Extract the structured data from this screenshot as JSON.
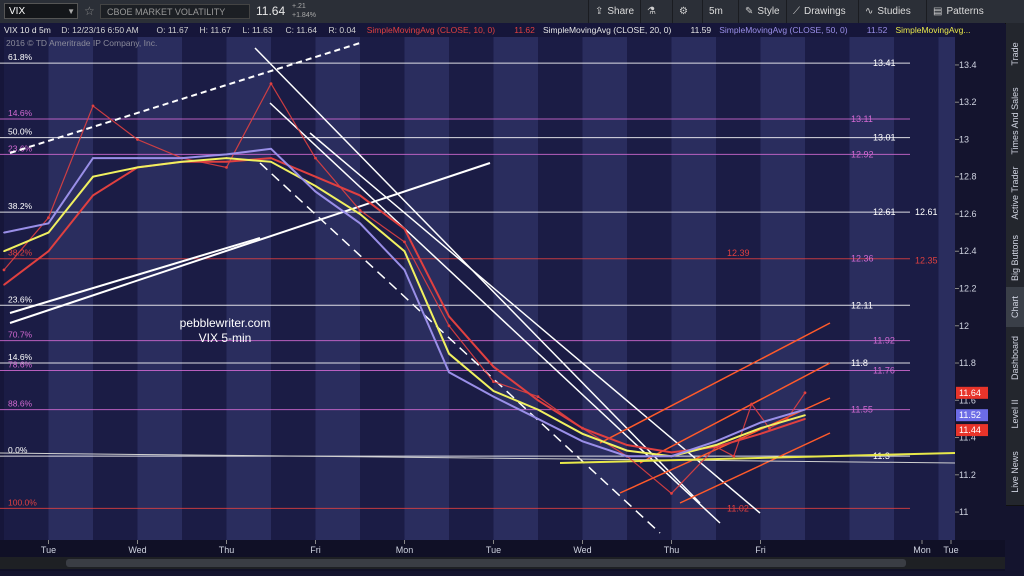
{
  "toolbar": {
    "symbol": "VIX",
    "description": "CBOE MARKET VOLATILITY INDEX",
    "last": "11.64",
    "change": "+.21",
    "change_pct": "+1.84%",
    "share": "Share",
    "timeframe": "5m",
    "style": "Style",
    "drawings": "Drawings",
    "studies": "Studies",
    "patterns": "Patterns"
  },
  "side_tabs": [
    "Trade",
    "Times And Sales",
    "Active Trader",
    "Big Buttons",
    "Chart",
    "Dashboard",
    "Level II",
    "Live News"
  ],
  "chart_data": {
    "type": "line",
    "header_items": [
      {
        "text": "VIX 10 d 5m",
        "color": "#e6e6e6"
      },
      {
        "text": "D: 12/23/16 6:50 AM",
        "color": "#cfcfcf"
      },
      {
        "text": "O: 11.67",
        "color": "#cfcfcf"
      },
      {
        "text": "H: 11.67",
        "color": "#cfcfcf"
      },
      {
        "text": "L: 11.63",
        "color": "#cfcfcf"
      },
      {
        "text": "C: 11.64",
        "color": "#cfcfcf"
      },
      {
        "text": "R: 0.04",
        "color": "#cfcfcf"
      },
      {
        "text": "SimpleMovingAvg (CLOSE, 10, 0)",
        "color": "#e04040"
      },
      {
        "text": "11.62",
        "color": "#e04040"
      },
      {
        "text": "SimpleMovingAvg (CLOSE, 20, 0)",
        "color": "#e6e6e6"
      },
      {
        "text": "11.59",
        "color": "#e6e6e6"
      },
      {
        "text": "SimpleMovingAvg (CLOSE, 50, 0)",
        "color": "#9a8fe8"
      },
      {
        "text": "11.52",
        "color": "#9a8fe8"
      },
      {
        "text": "SimpleMovingAvg...",
        "color": "#e8e84a"
      }
    ],
    "copyright": "2016 © TD Ameritrade IP Company, Inc.",
    "ylim": [
      10.85,
      13.55
    ],
    "y_ticks": [
      13.4,
      13.2,
      13.0,
      12.8,
      12.6,
      12.4,
      12.2,
      12.0,
      11.8,
      11.6,
      11.4,
      11.2,
      11.0
    ],
    "y_tick_labels": [
      "13.4",
      "13.2",
      "13",
      "12.8",
      "12.6",
      "12.4",
      "12.2",
      "12",
      "11.8",
      "11.6",
      "11.4",
      "11.2",
      "11"
    ],
    "x_tick_labels": [
      "Tue",
      "Wed",
      "Thu",
      "Fri",
      "Mon",
      "Tue",
      "Wed",
      "Thu",
      "Fri",
      "Mon",
      "Tue"
    ],
    "watermark": [
      "pebblewriter.com",
      "VIX 5-min"
    ],
    "fib_levels": [
      {
        "label": "61.8%",
        "value": 13.41,
        "color": "#ffffff"
      },
      {
        "label": "14.6%",
        "value": 13.11,
        "color": "#d36ad3"
      },
      {
        "label": "50.0%",
        "value": 13.01,
        "color": "#ffffff"
      },
      {
        "label": "23.6%",
        "value": 12.92,
        "color": "#d36ad3"
      },
      {
        "label": "38.2%",
        "value": 12.61,
        "color": "#ffffff"
      },
      {
        "label": "38.2%",
        "value": 12.36,
        "color": "#e04040"
      },
      {
        "label": "23.6%",
        "value": 12.11,
        "color": "#ffffff"
      },
      {
        "label": "70.7%",
        "value": 11.92,
        "color": "#d36ad3"
      },
      {
        "label": "14.6%",
        "value": 11.8,
        "color": "#ffffff"
      },
      {
        "label": "78.6%",
        "value": 11.76,
        "color": "#d36ad3"
      },
      {
        "label": "88.6%",
        "value": 11.55,
        "color": "#d36ad3"
      },
      {
        "label": "0.0%",
        "value": 11.3,
        "color": "#ffffff"
      },
      {
        "label": "100.0%",
        "value": 11.02,
        "color": "#e04040"
      }
    ],
    "level_labels": [
      {
        "text": "13.41",
        "value": 13.41,
        "color": "#ffffff"
      },
      {
        "text": "13.11",
        "value": 13.11,
        "color": "#d36ad3"
      },
      {
        "text": "13.01",
        "value": 13.01,
        "color": "#ffffff"
      },
      {
        "text": "12.92",
        "value": 12.92,
        "color": "#d36ad3"
      },
      {
        "text": "12.61",
        "value": 12.61,
        "color": "#ffffff"
      },
      {
        "text": "12.61",
        "value": 12.61,
        "color": "#ffffff"
      },
      {
        "text": "12.39",
        "value": 12.39,
        "color": "#e04040"
      },
      {
        "text": "12.36",
        "value": 12.36,
        "color": "#d36ad3"
      },
      {
        "text": "12.35",
        "value": 12.35,
        "color": "#e04040"
      },
      {
        "text": "12.11",
        "value": 12.11,
        "color": "#ffffff"
      },
      {
        "text": "11.92",
        "value": 11.92,
        "color": "#d36ad3"
      },
      {
        "text": "11.8",
        "value": 11.8,
        "color": "#ffffff"
      },
      {
        "text": "11.76",
        "value": 11.76,
        "color": "#d36ad3"
      },
      {
        "text": "11.55",
        "value": 11.55,
        "color": "#d36ad3"
      },
      {
        "text": "11.3",
        "value": 11.3,
        "color": "#ffffff"
      },
      {
        "text": "11.02",
        "value": 11.02,
        "color": "#e04040"
      }
    ],
    "price_flags": [
      {
        "text": "11.64",
        "value": 11.64,
        "color": "#e8342a"
      },
      {
        "text": "11.52",
        "value": 11.52,
        "color": "#6c6ce6"
      },
      {
        "text": "11.44",
        "value": 11.44,
        "color": "#e8342a"
      }
    ],
    "series": [
      {
        "name": "VIX",
        "color": "#e04040",
        "x": [
          0,
          0.5,
          1,
          1.5,
          2,
          2.5,
          3,
          3.5,
          4,
          4.5,
          5,
          5.5,
          6,
          6.5,
          7,
          7.5,
          8,
          8.2,
          8.4,
          8.6,
          8.8,
          9
        ],
        "values": [
          12.3,
          12.58,
          13.18,
          13.0,
          12.9,
          12.85,
          13.3,
          12.9,
          12.62,
          12.45,
          12.0,
          11.7,
          11.62,
          11.45,
          11.3,
          11.1,
          11.35,
          11.3,
          11.58,
          11.45,
          11.5,
          11.64
        ]
      },
      {
        "name": "",
        "color": "#e04040",
        "x": [
          0,
          0.5,
          1,
          1.5,
          2,
          2.5,
          3,
          3.5,
          4,
          4.5,
          5,
          5.5,
          6,
          6.5,
          7,
          7.5,
          8,
          8.5,
          9
        ],
        "values": [
          12.22,
          12.4,
          12.7,
          12.85,
          12.88,
          12.88,
          12.9,
          12.8,
          12.7,
          12.52,
          12.05,
          11.78,
          11.6,
          11.45,
          11.36,
          11.32,
          11.35,
          11.42,
          11.5
        ]
      },
      {
        "name": "",
        "color": "#f0f060",
        "x": [
          0,
          0.5,
          1,
          1.5,
          2,
          2.5,
          3,
          3.5,
          4,
          4.5,
          5,
          5.5,
          6,
          6.5,
          7,
          7.5,
          8,
          8.5,
          9
        ],
        "values": [
          12.4,
          12.5,
          12.8,
          12.85,
          12.88,
          12.9,
          12.88,
          12.75,
          12.6,
          12.4,
          11.85,
          11.65,
          11.55,
          11.42,
          11.33,
          11.3,
          11.36,
          11.45,
          11.52
        ]
      },
      {
        "name": "",
        "color": "#9a8fe8",
        "x": [
          0,
          0.5,
          1,
          1.5,
          2,
          2.5,
          3,
          3.5,
          4,
          4.5,
          5,
          5.5,
          6,
          6.5,
          7,
          7.5,
          8,
          8.5,
          9
        ],
        "values": [
          12.5,
          12.55,
          12.9,
          12.9,
          12.9,
          12.92,
          12.95,
          12.72,
          12.55,
          12.3,
          11.75,
          11.62,
          11.5,
          11.38,
          11.3,
          11.3,
          11.38,
          11.48,
          11.55
        ]
      }
    ]
  }
}
